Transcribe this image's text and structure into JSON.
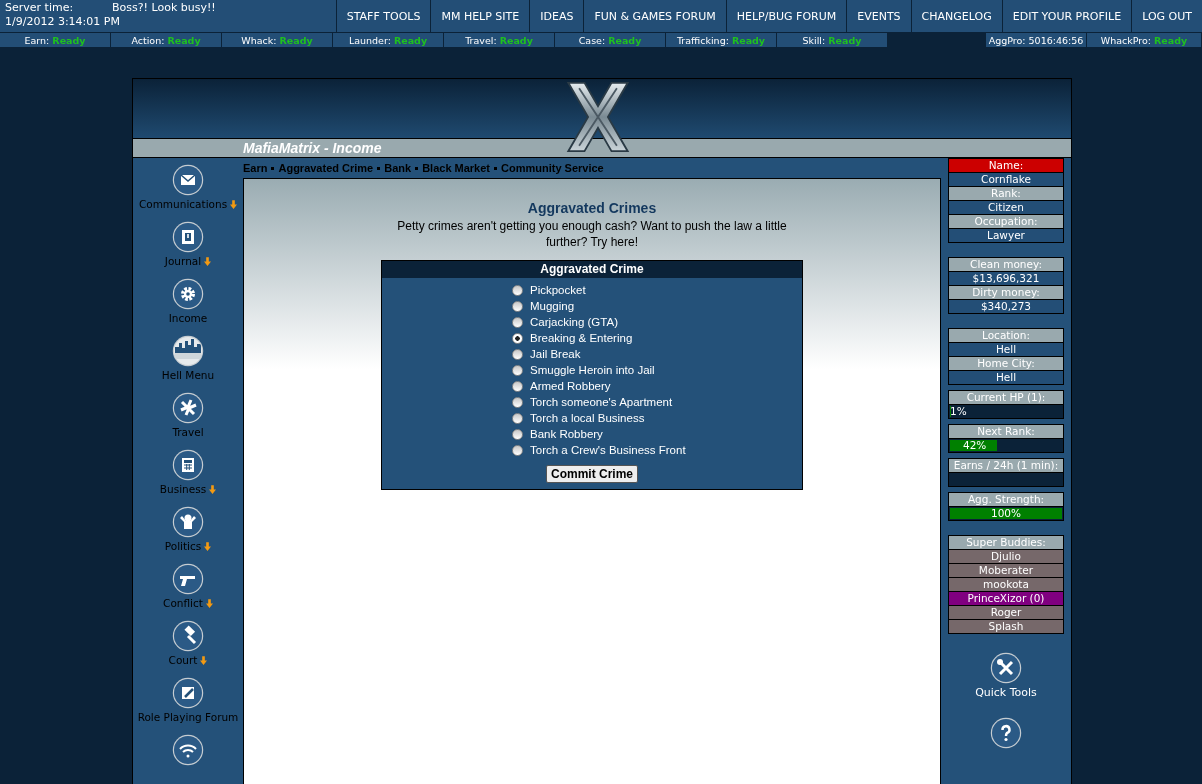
{
  "server": {
    "label": "Server time:",
    "time": "1/9/2012 3:14:01 PM",
    "message": "Boss?! Look busy!!"
  },
  "top_menu": [
    "STAFF TOOLS",
    "MM HELP SITE",
    "IDEAS",
    "FUN & GAMES FORUM",
    "HELP/BUG FORUM",
    "EVENTS",
    "CHANGELOG",
    "EDIT YOUR PROFILE",
    "LOG OUT"
  ],
  "timers_left": [
    {
      "label": "Earn:",
      "value": "Ready",
      "ready": true
    },
    {
      "label": "Action:",
      "value": "Ready",
      "ready": true
    },
    {
      "label": "Whack:",
      "value": "Ready",
      "ready": true
    },
    {
      "label": "Launder:",
      "value": "Ready",
      "ready": true
    },
    {
      "label": "Travel:",
      "value": "Ready",
      "ready": true
    },
    {
      "label": "Case:",
      "value": "Ready",
      "ready": true
    },
    {
      "label": "Trafficking:",
      "value": "Ready",
      "ready": true
    },
    {
      "label": "Skill:",
      "value": "Ready",
      "ready": true
    }
  ],
  "timers_right": [
    {
      "label": "AggPro:",
      "value": "5016:46:56",
      "ready": false
    },
    {
      "label": "WhackPro:",
      "value": "Ready",
      "ready": true
    }
  ],
  "page_title": "MafiaMatrix - Income",
  "sub_nav": [
    "Earn",
    "Aggravated Crime",
    "Bank",
    "Black Market",
    "Community Service"
  ],
  "sidebar": [
    {
      "label": "Communications",
      "kind": "mail",
      "dropdown": true
    },
    {
      "label": "Journal",
      "kind": "journal",
      "dropdown": true
    },
    {
      "label": "Income",
      "kind": "gear",
      "dropdown": false
    },
    {
      "label": "Hell Menu",
      "kind": "city",
      "dropdown": false
    },
    {
      "label": "Travel",
      "kind": "plane",
      "dropdown": false
    },
    {
      "label": "Business",
      "kind": "calculator",
      "dropdown": true
    },
    {
      "label": "Politics",
      "kind": "person",
      "dropdown": true
    },
    {
      "label": "Conflict",
      "kind": "gun",
      "dropdown": true
    },
    {
      "label": "Court",
      "kind": "hammer",
      "dropdown": true
    },
    {
      "label": "Role Playing Forum",
      "kind": "edit",
      "dropdown": false
    },
    {
      "kind": "wifi"
    }
  ],
  "crimes": {
    "heading": "Aggravated Crimes",
    "intro": "Petty crimes aren't getting you enough cash? Want to push the law a little further? Try here!",
    "table_title": "Aggravated Crime",
    "options": [
      {
        "label": "Pickpocket",
        "selected": false
      },
      {
        "label": "Mugging",
        "selected": false
      },
      {
        "label": "Carjacking (GTA)",
        "selected": false
      },
      {
        "label": "Breaking & Entering",
        "selected": true
      },
      {
        "label": "Jail Break",
        "selected": false
      },
      {
        "label": "Smuggle Heroin into Jail",
        "selected": false
      },
      {
        "label": "Armed Robbery",
        "selected": false
      },
      {
        "label": "Torch someone's Apartment",
        "selected": false
      },
      {
        "label": "Torch a local Business",
        "selected": false
      },
      {
        "label": "Bank Robbery",
        "selected": false
      },
      {
        "label": "Torch a Crew's Business Front",
        "selected": false
      }
    ],
    "button": "Commit Crime"
  },
  "stats": [
    {
      "rows": [
        {
          "kind": "label",
          "text": "Name:",
          "highlight": true
        },
        {
          "kind": "value",
          "text": "Cornflake"
        },
        {
          "kind": "label",
          "text": "Rank:",
          "highlight": false
        },
        {
          "kind": "value",
          "text": "Citizen"
        },
        {
          "kind": "label",
          "text": "Occupation:",
          "highlight": false
        },
        {
          "kind": "value",
          "text": "Lawyer"
        }
      ]
    },
    {
      "rows": [
        {
          "kind": "label",
          "text": "Clean money:",
          "highlight": false
        },
        {
          "kind": "value",
          "text": "$13,696,321"
        },
        {
          "kind": "label",
          "text": "Dirty money:",
          "highlight": false
        },
        {
          "kind": "value",
          "text": "$340,273"
        }
      ]
    },
    {
      "rows": [
        {
          "kind": "label",
          "text": "Location:",
          "highlight": false
        },
        {
          "kind": "value",
          "text": "Hell"
        },
        {
          "kind": "label",
          "text": "Home City:",
          "highlight": false
        },
        {
          "kind": "value",
          "text": "Hell"
        }
      ]
    },
    {
      "rows": [
        {
          "kind": "label",
          "text": "Current HP (1):",
          "highlight": false
        },
        {
          "kind": "bar",
          "text": "1%",
          "level": 0.01
        }
      ]
    },
    {
      "rows": [
        {
          "kind": "label",
          "text": "Next Rank:",
          "highlight": false
        },
        {
          "kind": "bar",
          "text": "42%",
          "level": 0.42
        }
      ]
    },
    {
      "rows": [
        {
          "kind": "label",
          "text": "Earns / 24h (1 min):",
          "highlight": false
        },
        {
          "kind": "bar",
          "level": 0
        }
      ]
    },
    {
      "rows": [
        {
          "kind": "label",
          "text": "Agg. Strength:",
          "highlight": false
        },
        {
          "kind": "bar",
          "text": "100%",
          "level": 1
        }
      ]
    },
    {
      "rows": [
        {
          "kind": "label",
          "text": "Super Buddies:",
          "highlight": false
        },
        {
          "kind": "buddy",
          "text": "Djulio",
          "color": "#76686a"
        },
        {
          "kind": "buddy",
          "text": "Moberater",
          "color": "#76686a"
        },
        {
          "kind": "buddy",
          "text": "mookota",
          "color": "#76686a"
        },
        {
          "kind": "buddy",
          "text": "PrinceXizor (0)",
          "color": "#800080"
        },
        {
          "kind": "buddy",
          "text": "Roger",
          "color": "#76686a"
        },
        {
          "kind": "buddy",
          "text": "Splash",
          "color": "#76686a"
        }
      ]
    }
  ],
  "right_tools": [
    {
      "label": "Quick Tools",
      "kind": "tools"
    },
    {
      "kind": "help"
    }
  ]
}
